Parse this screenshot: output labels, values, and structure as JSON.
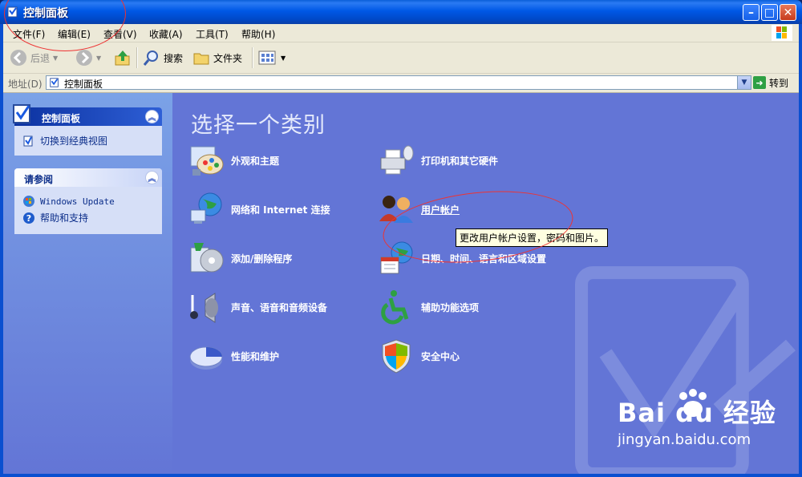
{
  "window": {
    "title": "控制面板",
    "buttons": {
      "minimize": "–",
      "maximize": "□",
      "close": "✕"
    }
  },
  "menubar": {
    "items": [
      "文件(F)",
      "编辑(E)",
      "查看(V)",
      "收藏(A)",
      "工具(T)",
      "帮助(H)"
    ]
  },
  "toolbar": {
    "back_label": "后退",
    "forward_label": "",
    "search_label": "搜索",
    "folders_label": "文件夹"
  },
  "address": {
    "label": "地址(D)",
    "value": "控制面板",
    "go_label": "转到"
  },
  "sidebar": {
    "panels": [
      {
        "title": "控制面板",
        "links": [
          "切换到经典视图"
        ]
      },
      {
        "title": "请参阅",
        "links": [
          "Windows Update",
          "帮助和支持"
        ]
      }
    ]
  },
  "main": {
    "heading": "选择一个类别",
    "categories_left": [
      "外观和主题",
      "网络和 Internet 连接",
      "添加/删除程序",
      "声音、语音和音频设备",
      "性能和维护"
    ],
    "categories_right": [
      "打印机和其它硬件",
      "用户帐户",
      "日期、时间、语言和区域设置",
      "辅助功能选项",
      "安全中心"
    ],
    "tooltip": "更改用户帐户设置，密码和图片。"
  },
  "watermark": {
    "logo": "Bai du 经验",
    "url": "jingyan.baidu.com"
  },
  "colors": {
    "title_bar": "#0058e6",
    "sidebar": "#7ba2e7",
    "content": "#6375d6",
    "annotation": "#e33333"
  }
}
